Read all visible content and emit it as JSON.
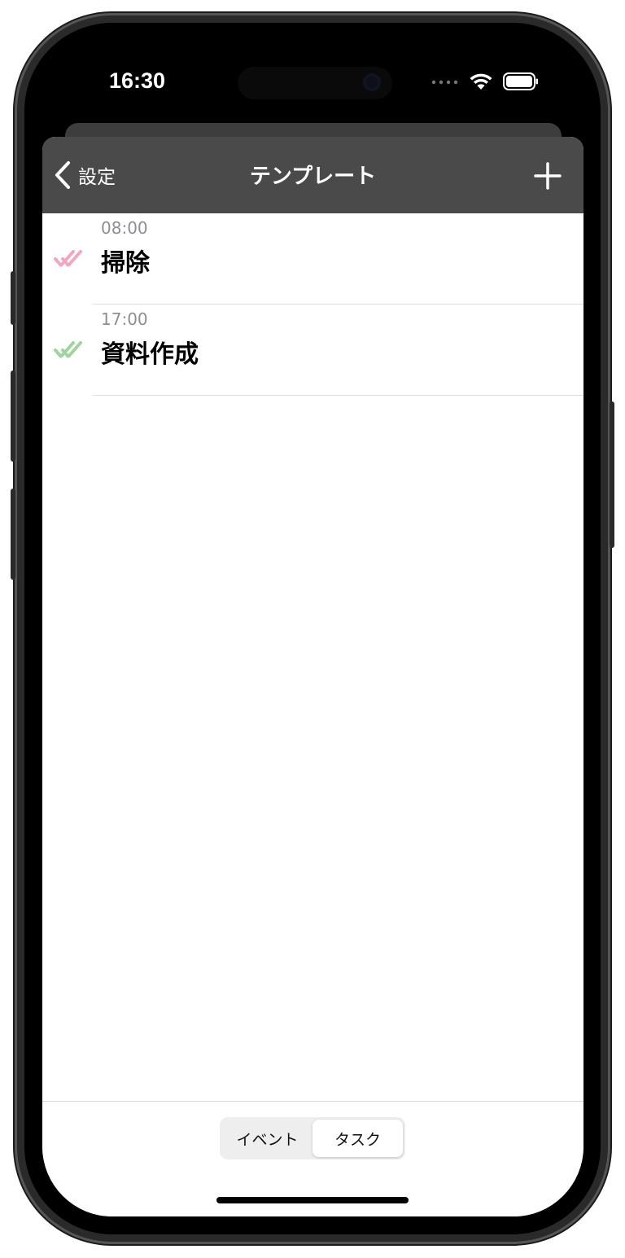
{
  "status_bar": {
    "time": "16:30",
    "icons": [
      "cellular-dots-icon",
      "wifi-icon",
      "battery-icon"
    ]
  },
  "navbar": {
    "back_label": "設定",
    "title": "テンプレート",
    "add_icon": "plus-icon",
    "background_color": "#4a4a4a"
  },
  "templates": [
    {
      "time": "08:00",
      "title": "掃除",
      "check_color": "#f2a6c0"
    },
    {
      "time": "17:00",
      "title": "資料作成",
      "check_color": "#9fd49c"
    }
  ],
  "segmented_control": {
    "options": [
      "イベント",
      "タスク"
    ],
    "selected": "タスク"
  }
}
